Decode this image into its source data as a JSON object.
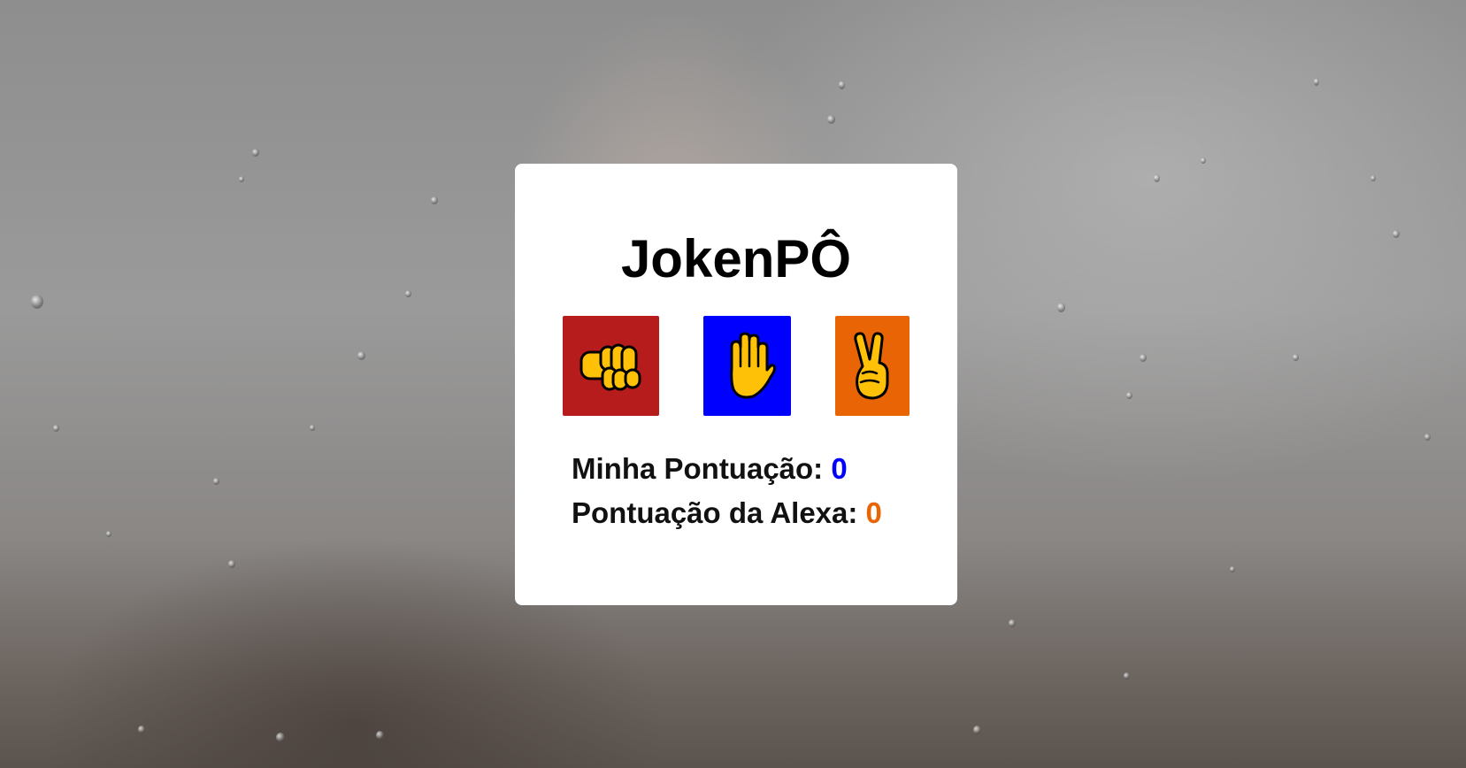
{
  "title": "JokenPÔ",
  "choices": [
    {
      "name": "rock",
      "icon": "fist-icon",
      "color": "#b71c1c"
    },
    {
      "name": "paper",
      "icon": "raised-hand-icon",
      "color": "#0000ff"
    },
    {
      "name": "scissors",
      "icon": "victory-hand-icon",
      "color": "#e86405"
    }
  ],
  "scores": {
    "player_label": "Minha Pontuação:",
    "player_value": "0",
    "player_color": "#0000ff",
    "computer_label": "Pontuação da Alexa:",
    "computer_value": "0",
    "computer_color": "#e86405"
  }
}
